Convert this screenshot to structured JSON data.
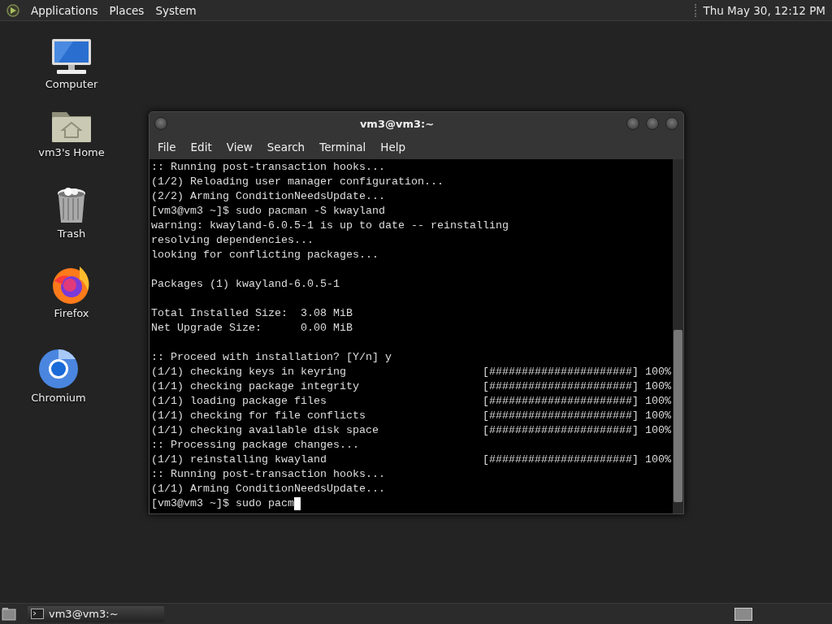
{
  "top_panel": {
    "menus": [
      "Applications",
      "Places",
      "System"
    ],
    "clock": "Thu May 30, 12:12 PM"
  },
  "desktop_icons": [
    {
      "kind": "computer",
      "label": "Computer"
    },
    {
      "kind": "home",
      "label": "vm3's Home"
    },
    {
      "kind": "trash",
      "label": "Trash"
    },
    {
      "kind": "firefox",
      "label": "Firefox"
    },
    {
      "kind": "chromium",
      "label": "Chromium"
    }
  ],
  "window": {
    "title": "vm3@vm3:~",
    "menu": [
      "File",
      "Edit",
      "View",
      "Search",
      "Terminal",
      "Help"
    ],
    "lines": [
      {
        "kind": "text",
        "text": ":: Running post-transaction hooks..."
      },
      {
        "kind": "text",
        "text": "(1/2) Reloading user manager configuration..."
      },
      {
        "kind": "text",
        "text": "(2/2) Arming ConditionNeedsUpdate..."
      },
      {
        "kind": "text",
        "text": "[vm3@vm3 ~]$ sudo pacman -S kwayland"
      },
      {
        "kind": "text",
        "text": "warning: kwayland-6.0.5-1 is up to date -- reinstalling"
      },
      {
        "kind": "text",
        "text": "resolving dependencies..."
      },
      {
        "kind": "text",
        "text": "looking for conflicting packages..."
      },
      {
        "kind": "blank"
      },
      {
        "kind": "text",
        "text": "Packages (1) kwayland-6.0.5-1"
      },
      {
        "kind": "blank"
      },
      {
        "kind": "text",
        "text": "Total Installed Size:  3.08 MiB"
      },
      {
        "kind": "text",
        "text": "Net Upgrade Size:      0.00 MiB"
      },
      {
        "kind": "blank"
      },
      {
        "kind": "text",
        "text": ":: Proceed with installation? [Y/n] y"
      },
      {
        "kind": "progress",
        "text": "(1/1) checking keys in keyring",
        "bar": "[######################]",
        "percent": "100%"
      },
      {
        "kind": "progress",
        "text": "(1/1) checking package integrity",
        "bar": "[######################]",
        "percent": "100%"
      },
      {
        "kind": "progress",
        "text": "(1/1) loading package files",
        "bar": "[######################]",
        "percent": "100%"
      },
      {
        "kind": "progress",
        "text": "(1/1) checking for file conflicts",
        "bar": "[######################]",
        "percent": "100%"
      },
      {
        "kind": "progress",
        "text": "(1/1) checking available disk space",
        "bar": "[######################]",
        "percent": "100%"
      },
      {
        "kind": "text",
        "text": ":: Processing package changes..."
      },
      {
        "kind": "progress",
        "text": "(1/1) reinstalling kwayland",
        "bar": "[######################]",
        "percent": "100%"
      },
      {
        "kind": "text",
        "text": ":: Running post-transaction hooks..."
      },
      {
        "kind": "text",
        "text": "(1/1) Arming ConditionNeedsUpdate..."
      },
      {
        "kind": "input",
        "text": "[vm3@vm3 ~]$ sudo pacm"
      }
    ]
  },
  "taskbar": {
    "tasks": [
      {
        "label": "vm3@vm3:~",
        "selected": true
      }
    ]
  }
}
